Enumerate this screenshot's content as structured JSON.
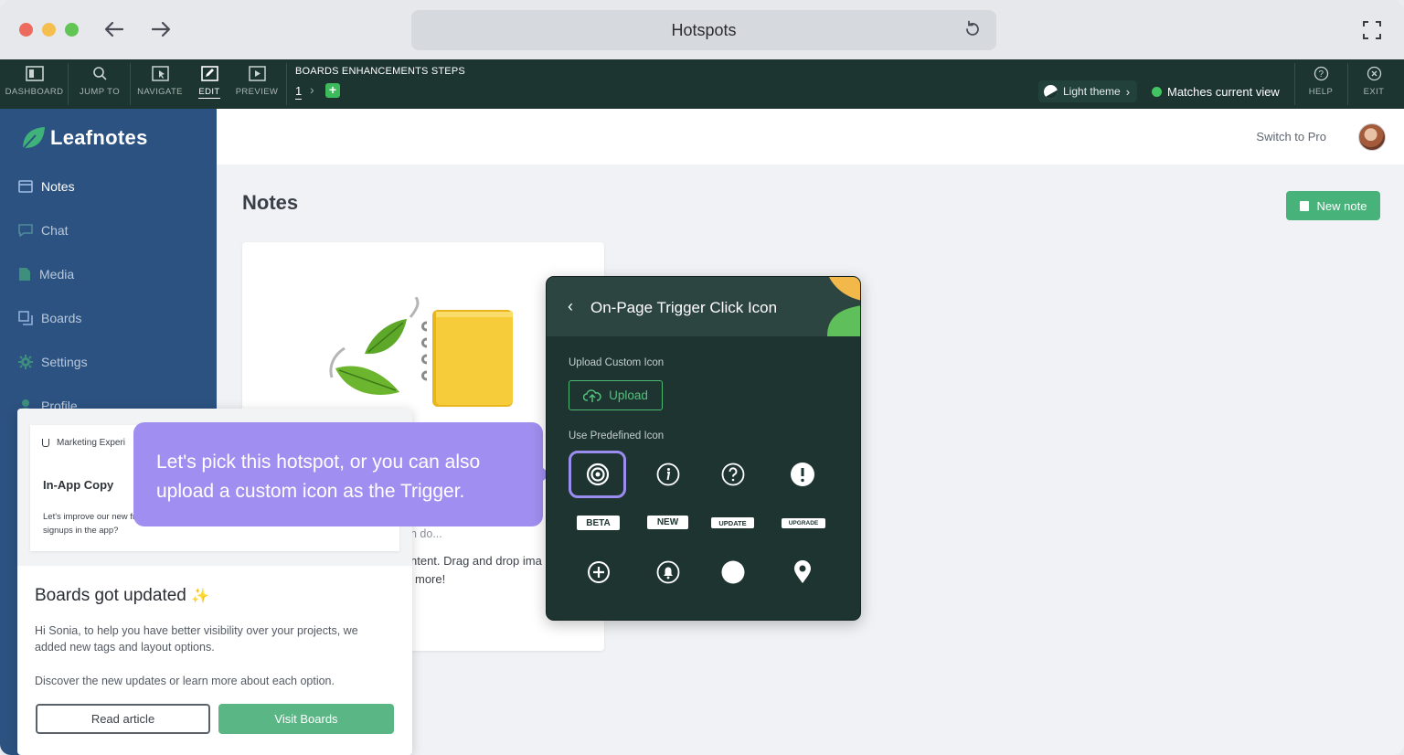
{
  "browser": {
    "title": "Hotspots",
    "colors": {
      "close": "#ec6b5e",
      "minimize": "#f4bf4f",
      "maximize": "#61c554"
    }
  },
  "editor_toolbar": {
    "tools": [
      {
        "label": "DASHBOARD",
        "icon": "dashboard-icon"
      },
      {
        "label": "JUMP TO",
        "icon": "search-icon"
      },
      {
        "label": "NAVIGATE",
        "icon": "cursor-icon"
      },
      {
        "label": "EDIT",
        "icon": "edit-icon",
        "active": true
      },
      {
        "label": "PREVIEW",
        "icon": "play-icon"
      }
    ],
    "steps_title": "BOARDS ENHANCEMENTS STEPS",
    "current_step": "1",
    "add_step": "+",
    "theme_label": "Light theme",
    "match_label": "Matches current view",
    "help_label": "HELP",
    "exit_label": "EXIT"
  },
  "app": {
    "brand": "Leafnotes",
    "sidebar": [
      {
        "label": "Notes",
        "icon": "notes-icon",
        "active": true
      },
      {
        "label": "Chat",
        "icon": "chat-icon"
      },
      {
        "label": "Media",
        "icon": "media-icon"
      },
      {
        "label": "Boards",
        "icon": "boards-icon"
      },
      {
        "label": "Settings",
        "icon": "gear-icon"
      },
      {
        "label": "Profile",
        "icon": "user-icon"
      }
    ],
    "switch_pro": "Switch to Pro",
    "page_title": "Notes",
    "new_note": "New note",
    "note_card": {
      "line_a": "n do...",
      "line_b": "ntent. Drag and drop ima",
      "line_c": "more!"
    }
  },
  "popup": {
    "preview": {
      "tag": "Marketing Experi",
      "heading": "In-App Copy",
      "text": "Let's improve our new from new signups in the app?"
    },
    "title": "Boards got updated",
    "sparkle": "✨",
    "body1": "Hi Sonia, to help you have better visibility over your projects, we added new tags and layout options.",
    "body2": "Discover the new updates or learn more about each option.",
    "read_button": "Read article",
    "visit_button": "Visit Boards"
  },
  "tooltip": {
    "text": "Let's pick this hotspot, or you can also upload a custom icon as the Trigger."
  },
  "trigger_panel": {
    "title": "On-Page Trigger Click Icon",
    "upload_label": "Upload Custom Icon",
    "upload_button": "Upload",
    "predefined_label": "Use Predefined Icon",
    "badges": [
      "BETA",
      "NEW",
      "UPDATE",
      "UPGRADE"
    ],
    "accent": "#9b8cf0",
    "green": "#4cb872"
  }
}
